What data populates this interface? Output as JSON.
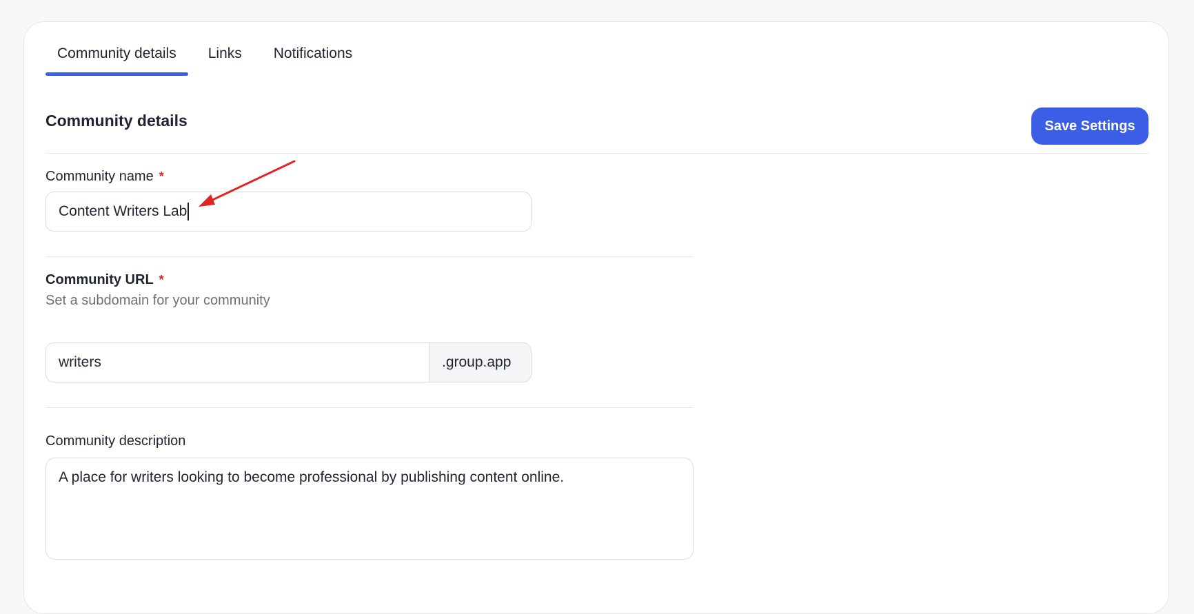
{
  "tabs": [
    {
      "label": "Community details",
      "active": true
    },
    {
      "label": "Links",
      "active": false
    },
    {
      "label": "Notifications",
      "active": false
    }
  ],
  "section": {
    "title": "Community details",
    "save_label": "Save Settings"
  },
  "fields": {
    "name": {
      "label": "Community name",
      "required_mark": "*",
      "value": "Content Writers Lab"
    },
    "url": {
      "label": "Community URL",
      "required_mark": "*",
      "helper": "Set a subdomain for your community",
      "value": "writers",
      "suffix": ".group.app"
    },
    "description": {
      "label": "Community description",
      "value": "A place for writers looking to become professional by publishing content online."
    }
  },
  "colors": {
    "accent": "#3a5ee6",
    "required": "#e02424",
    "annotation_arrow": "#e02424"
  }
}
